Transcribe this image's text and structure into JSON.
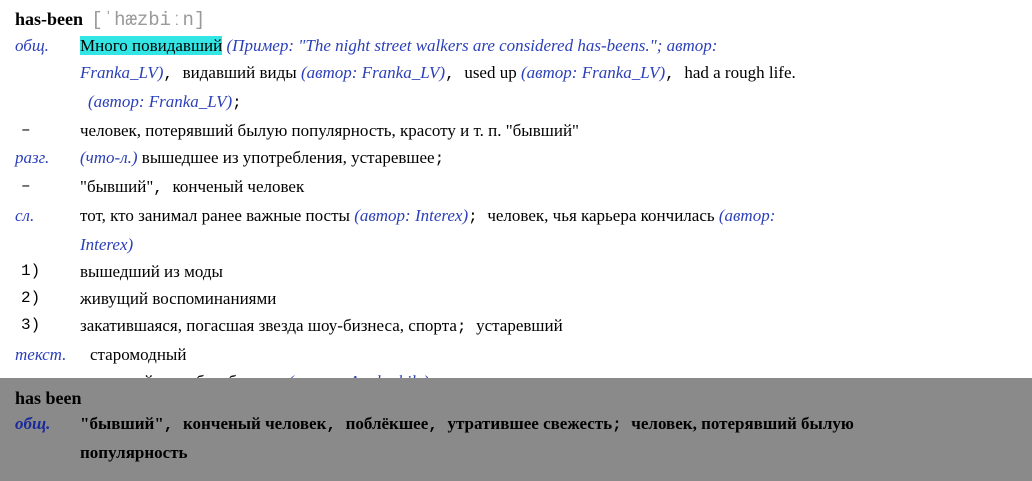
{
  "entry": {
    "headword": "has-been",
    "transcription": "[ˈhæzbiːn]",
    "senses": [
      {
        "label": "общ.",
        "parts": [
          {
            "t": "Много повидавший",
            "style": "hl"
          },
          {
            "t": " (Пример: \"The night street walkers are considered has-beens.\"; автор:",
            "style": "auth"
          }
        ],
        "line2": [
          {
            "t": "Franka_LV)",
            "style": "auth"
          },
          {
            "t": ", ",
            "style": "sep"
          },
          {
            "t": "видавший виды ",
            "style": ""
          },
          {
            "t": "(автор: Franka_LV)",
            "style": "auth"
          },
          {
            "t": ", ",
            "style": "sep"
          },
          {
            "t": "used up ",
            "style": ""
          },
          {
            "t": "(автор: Franka_LV)",
            "style": "auth"
          },
          {
            "t": ", ",
            "style": "sep"
          },
          {
            "t": "had a rough life.",
            "style": ""
          }
        ],
        "line3": [
          {
            "t": "(автор: Franka_LV)",
            "style": "auth"
          },
          {
            "t": ";",
            "style": "sep"
          }
        ]
      },
      {
        "label": "–",
        "text": "человек, потерявший былую популярность, красоту и т. п. \"бывший\""
      },
      {
        "label": "разг.",
        "note": "(что-л.)",
        "text": " вышедшее из употребления, устаревшее",
        "tail": ";"
      },
      {
        "label": "–",
        "text": "\"бывший\"",
        "tail2": ", ",
        "text2": "конченый человек"
      },
      {
        "label": "сл.",
        "text": "тот, кто занимал ранее важные посты ",
        "auth1": "(автор: Interex)",
        "mid": "; ",
        "text2": "человек, чья карьера кончилась ",
        "auth2": "(автор:",
        "auth2b": "Interex)"
      },
      {
        "label": "1)",
        "text": "вышедший из моды"
      },
      {
        "label": "2)",
        "text": "живущий воспоминаниями"
      },
      {
        "label": "3)",
        "text": "закатившаяся, погасшая звезда шоу-бизнеса, спорта",
        "mid": "; ",
        "text2": "устаревший"
      },
      {
        "label": "текст.",
        "text": "старомодный"
      },
      {
        "label": "шутл.",
        "text": "отставной козы барабанщик ",
        "auth1": "(автор: Anglophile)"
      }
    ]
  },
  "overlay": {
    "headword": "has been",
    "label": "общ.",
    "items": [
      "\"бывший\"",
      "конченый человек",
      "поблёкшее",
      "утратившее свежесть",
      "человек, потерявший былую"
    ],
    "continuation": "популярность"
  },
  "colors": {
    "label": "#2b3fb8",
    "highlight": "#33e6e6",
    "overlay": "#8a8a8a"
  }
}
